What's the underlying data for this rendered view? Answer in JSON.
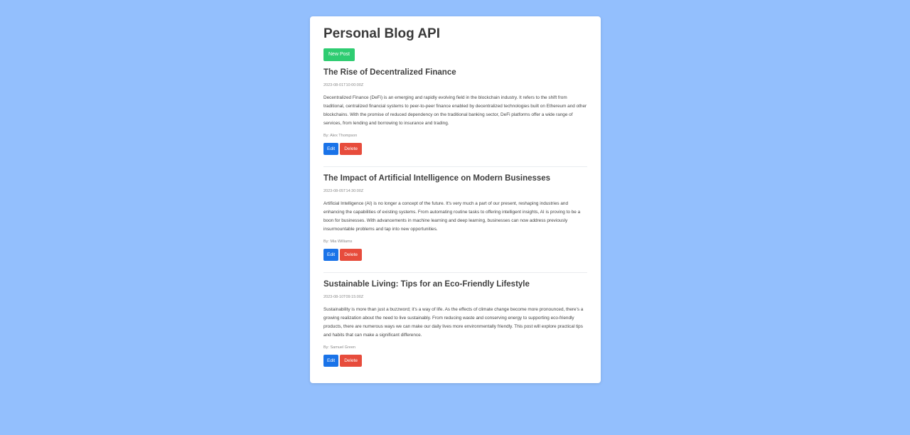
{
  "header": {
    "title": "Personal Blog API",
    "new_post_label": "New Post"
  },
  "colors": {
    "background": "#93bffd",
    "new_post": "#2ecc71",
    "edit": "#1a73e8",
    "delete": "#e74c3c"
  },
  "posts": [
    {
      "title": "The Rise of Decentralized Finance",
      "date": "2023-08-01T10:00:00Z",
      "body": "Decentralized Finance (DeFi) is an emerging and rapidly evolving field in the blockchain industry. It refers to the shift from traditional, centralized financial systems to peer-to-peer finance enabled by decentralized technologies built on Ethereum and other blockchains. With the promise of reduced dependency on the traditional banking sector, DeFi platforms offer a wide range of services, from lending and borrowing to insurance and trading.",
      "author": "By: Alex Thompson",
      "edit_label": "Edit",
      "delete_label": "Delete"
    },
    {
      "title": "The Impact of Artificial Intelligence on Modern Businesses",
      "date": "2023-08-05T14:30:00Z",
      "body": "Artificial Intelligence (AI) is no longer a concept of the future. It's very much a part of our present, reshaping industries and enhancing the capabilities of existing systems. From automating routine tasks to offering intelligent insights, AI is proving to be a boon for businesses. With advancements in machine learning and deep learning, businesses can now address previously insurmountable problems and tap into new opportunities.",
      "author": "By: Mia Williams",
      "edit_label": "Edit",
      "delete_label": "Delete"
    },
    {
      "title": "Sustainable Living: Tips for an Eco-Friendly Lifestyle",
      "date": "2023-08-10T09:15:00Z",
      "body": "Sustainability is more than just a buzzword; it's a way of life. As the effects of climate change become more pronounced, there's a growing realization about the need to live sustainably. From reducing waste and conserving energy to supporting eco-friendly products, there are numerous ways we can make our daily lives more environmentally friendly. This post will explore practical tips and habits that can make a significant difference.",
      "author": "By: Samuel Green",
      "edit_label": "Edit",
      "delete_label": "Delete"
    }
  ]
}
